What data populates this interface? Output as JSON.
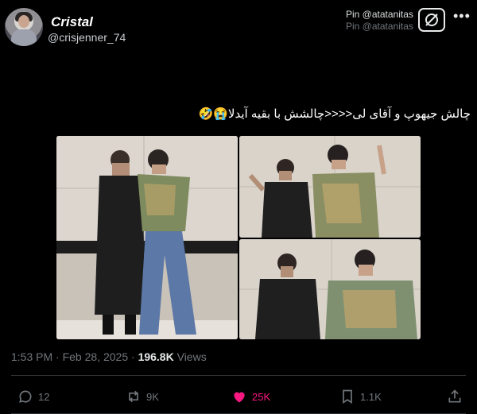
{
  "author": {
    "display_name": "Cristal",
    "handle": "@crisjenner_74"
  },
  "pin": {
    "label": "Pin @atatanitas",
    "sub": "Pin @atatanitas"
  },
  "tweet_text": "چالش جیهوپ و آقای لی<<<<چالشش با بقیه آیدلا😭🤣",
  "meta": {
    "time": "1:53 PM",
    "date": "Feb 28, 2025",
    "views_count": "196.8K",
    "views_label": "Views"
  },
  "actions": {
    "replies": "12",
    "reposts": "9K",
    "likes": "25K",
    "bookmarks": "1.1K"
  },
  "colors": {
    "like": "#f91880",
    "muted": "#71767b",
    "text": "#e7e9ea"
  },
  "icons": [
    "reply-icon",
    "repost-icon",
    "heart-icon",
    "bookmark-icon",
    "share-icon",
    "pin-icon",
    "more-icon"
  ]
}
